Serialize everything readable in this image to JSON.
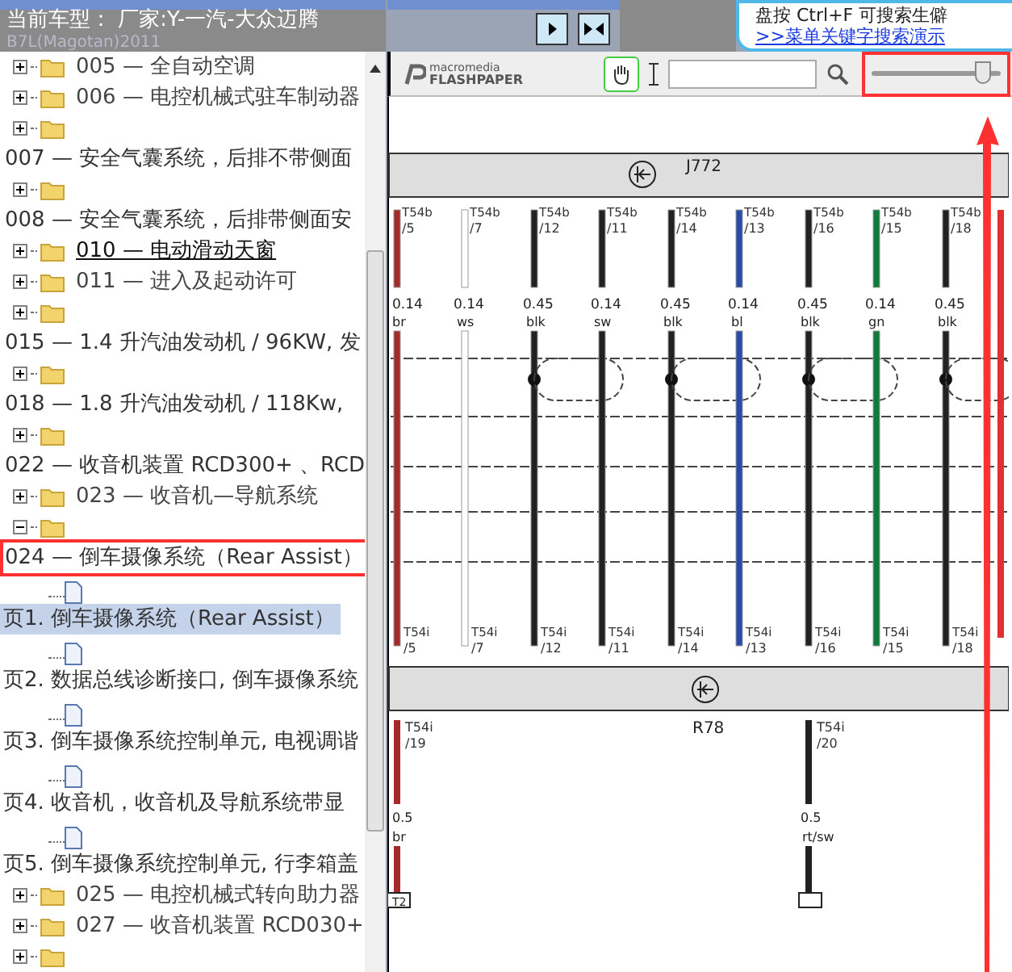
{
  "header": {
    "title": "当前车型： 厂家:Y-一汽-大众迈腾",
    "subtitle": "B7L(Magotan)2011"
  },
  "banner": {
    "tip": "盘按 Ctrl+F 可搜索生僻",
    "link": ">>菜单关键字搜索演示"
  },
  "toolbar": {
    "logo_top": "macromedia",
    "logo_bottom": "FLASHPAPER",
    "hand_tool_selected": true,
    "zoom": {
      "level": 0.86,
      "highlighted": true
    }
  },
  "tree": [
    {
      "kind": "folder",
      "expanded": false,
      "label": "005 — 全自动空调",
      "hovered": false
    },
    {
      "kind": "folder",
      "expanded": false,
      "label": "006 — 电控机械式驻车制动器",
      "hovered": false
    },
    {
      "kind": "folder",
      "expanded": false
    },
    {
      "kind": "title",
      "label": "007 — 安全气囊系统，后排不带侧面",
      "highlighted": false
    },
    {
      "kind": "folder",
      "expanded": false
    },
    {
      "kind": "title",
      "label": "008 — 安全气囊系统，后排带侧面安",
      "highlighted": false
    },
    {
      "kind": "folder",
      "expanded": false,
      "label": "010 — 电动滑动天窗",
      "hovered": true
    },
    {
      "kind": "folder",
      "expanded": false,
      "label": "011 — 进入及起动许可",
      "hovered": false
    },
    {
      "kind": "folder",
      "expanded": false
    },
    {
      "kind": "title",
      "label": "015 — 1.4 升汽油发动机 / 96KW, 发",
      "highlighted": false
    },
    {
      "kind": "folder",
      "expanded": false
    },
    {
      "kind": "title",
      "label": "018 — 1.8 升汽油发动机 / 118Kw,",
      "highlighted": false
    },
    {
      "kind": "folder",
      "expanded": false
    },
    {
      "kind": "title",
      "label": "022 — 收音机装置 RCD300+ 、RCD",
      "highlighted": false
    },
    {
      "kind": "folder",
      "expanded": false,
      "label": "023 — 收音机—导航系统",
      "hovered": false
    },
    {
      "kind": "folder",
      "expanded": true
    },
    {
      "kind": "title",
      "label": "024 — 倒车摄像系统（Rear Assist）",
      "highlighted": true
    },
    {
      "kind": "page"
    },
    {
      "kind": "page_title",
      "label": "页1. 倒车摄像系统（Rear Assist）",
      "selected": true
    },
    {
      "kind": "page"
    },
    {
      "kind": "page_title",
      "label": "页2. 数据总线诊断接口, 倒车摄像系统",
      "selected": false
    },
    {
      "kind": "page"
    },
    {
      "kind": "page_title",
      "label": "页3. 倒车摄像系统控制单元, 电视调谐",
      "selected": false
    },
    {
      "kind": "page"
    },
    {
      "kind": "page_title",
      "label": "页4. 收音机，收音机及导航系统带显",
      "selected": false
    },
    {
      "kind": "page"
    },
    {
      "kind": "page_title",
      "label": "页5. 倒车摄像系统控制单元, 行李箱盖",
      "selected": false
    },
    {
      "kind": "folder",
      "expanded": false,
      "label": "025 — 电控机械式转向助力器",
      "hovered": false
    },
    {
      "kind": "folder",
      "expanded": false,
      "label": "027 — 收音机装置 RCD030+",
      "hovered": false
    },
    {
      "kind": "folder",
      "expanded": false
    }
  ],
  "diagram": {
    "top_component": "J772",
    "bottom_component": "R78",
    "wires": [
      {
        "kind": "full",
        "color": "#a52a2a",
        "pin": "T54b",
        "pin_no": "/5",
        "size": "0.14",
        "code": "br",
        "end_pin": "T54i",
        "end_no": "/5",
        "node": false,
        "lower": {
          "pin": "T54i",
          "pin_no": "/19",
          "size": "0.5",
          "code": "br",
          "terminal": "T2"
        }
      },
      {
        "kind": "full",
        "color": "#ffffff",
        "pin": "T54b",
        "pin_no": "/7",
        "size": "0.14",
        "code": "ws",
        "end_pin": "T54i",
        "end_no": "/7",
        "node": false
      },
      {
        "kind": "full",
        "color": "#222222",
        "pin": "T54b",
        "pin_no": "/12",
        "size": "0.45",
        "code": "blk",
        "end_pin": "T54i",
        "end_no": "/12",
        "node": true
      },
      {
        "kind": "full",
        "color": "#222222",
        "pin": "T54b",
        "pin_no": "/11",
        "size": "0.14",
        "code": "sw",
        "end_pin": "T54i",
        "end_no": "/11",
        "node": false
      },
      {
        "kind": "full",
        "color": "#222222",
        "pin": "T54b",
        "pin_no": "/14",
        "size": "0.45",
        "code": "blk",
        "end_pin": "T54i",
        "end_no": "/14",
        "node": true
      },
      {
        "kind": "full",
        "color": "#2a4aa8",
        "pin": "T54b",
        "pin_no": "/13",
        "size": "0.14",
        "code": "bl",
        "end_pin": "T54i",
        "end_no": "/13",
        "node": false
      },
      {
        "kind": "full",
        "color": "#222222",
        "pin": "T54b",
        "pin_no": "/16",
        "size": "0.45",
        "code": "blk",
        "end_pin": "T54i",
        "end_no": "/16",
        "node": true,
        "lower": {
          "pin": "T54i",
          "pin_no": "/20",
          "size": "0.5",
          "code": "rt/sw"
        }
      },
      {
        "kind": "full",
        "color": "#107a3a",
        "pin": "T54b",
        "pin_no": "/15",
        "size": "0.14",
        "code": "gn",
        "end_pin": "T54i",
        "end_no": "/15",
        "node": false
      },
      {
        "kind": "full",
        "color": "#222222",
        "pin": "T54b",
        "pin_no": "/18",
        "size": "0.45",
        "code": "blk",
        "end_pin": "T54i",
        "end_no": "/18",
        "node": true
      },
      {
        "kind": "partial",
        "color": "#e03030"
      }
    ]
  }
}
